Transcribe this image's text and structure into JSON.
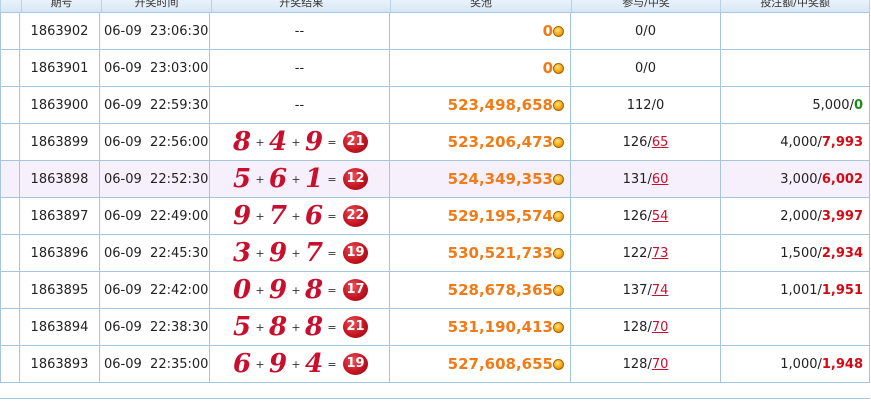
{
  "header": {
    "issue": "期号",
    "time": "开奖时间",
    "result": "开奖结果",
    "pool": "奖池",
    "participation": "参与/中奖",
    "bet_win": "投注额/中奖额"
  },
  "rows": [
    {
      "issue": "1863902",
      "date": "06-09",
      "time": "23:06:30",
      "result": "--",
      "d1": "",
      "d2": "",
      "d3": "",
      "sum": "",
      "pool": "0",
      "part": "0",
      "winners": "0",
      "bet": "",
      "won": "",
      "won_color": "",
      "highlight": false
    },
    {
      "issue": "1863901",
      "date": "06-09",
      "time": "23:03:00",
      "result": "--",
      "d1": "",
      "d2": "",
      "d3": "",
      "sum": "",
      "pool": "0",
      "part": "0",
      "winners": "0",
      "bet": "",
      "won": "",
      "won_color": "",
      "highlight": false
    },
    {
      "issue": "1863900",
      "date": "06-09",
      "time": "22:59:30",
      "result": "--",
      "d1": "",
      "d2": "",
      "d3": "",
      "sum": "",
      "pool": "523,498,658",
      "part": "112",
      "winners": "0",
      "bet": "5,000",
      "won": "0",
      "won_color": "green",
      "highlight": false
    },
    {
      "issue": "1863899",
      "date": "06-09",
      "time": "22:56:00",
      "result": "",
      "d1": "8",
      "d2": "4",
      "d3": "9",
      "sum": "21",
      "pool": "523,206,473",
      "part": "126",
      "winners": "65",
      "bet": "4,000",
      "won": "7,993",
      "won_color": "red",
      "highlight": false
    },
    {
      "issue": "1863898",
      "date": "06-09",
      "time": "22:52:30",
      "result": "",
      "d1": "5",
      "d2": "6",
      "d3": "1",
      "sum": "12",
      "pool": "524,349,353",
      "part": "131",
      "winners": "60",
      "bet": "3,000",
      "won": "6,002",
      "won_color": "red",
      "highlight": true
    },
    {
      "issue": "1863897",
      "date": "06-09",
      "time": "22:49:00",
      "result": "",
      "d1": "9",
      "d2": "7",
      "d3": "6",
      "sum": "22",
      "pool": "529,195,574",
      "part": "126",
      "winners": "54",
      "bet": "2,000",
      "won": "3,997",
      "won_color": "red",
      "highlight": false
    },
    {
      "issue": "1863896",
      "date": "06-09",
      "time": "22:45:30",
      "result": "",
      "d1": "3",
      "d2": "9",
      "d3": "7",
      "sum": "19",
      "pool": "530,521,733",
      "part": "122",
      "winners": "73",
      "bet": "1,500",
      "won": "2,934",
      "won_color": "red",
      "highlight": false
    },
    {
      "issue": "1863895",
      "date": "06-09",
      "time": "22:42:00",
      "result": "",
      "d1": "0",
      "d2": "9",
      "d3": "8",
      "sum": "17",
      "pool": "528,678,365",
      "part": "137",
      "winners": "74",
      "bet": "1,001",
      "won": "1,951",
      "won_color": "red",
      "highlight": false
    },
    {
      "issue": "1863894",
      "date": "06-09",
      "time": "22:38:30",
      "result": "",
      "d1": "5",
      "d2": "8",
      "d3": "8",
      "sum": "21",
      "pool": "531,190,413",
      "part": "128",
      "winners": "70",
      "bet": "",
      "won": "",
      "won_color": "",
      "highlight": false
    },
    {
      "issue": "1863893",
      "date": "06-09",
      "time": "22:35:00",
      "result": "",
      "d1": "6",
      "d2": "9",
      "d3": "4",
      "sum": "19",
      "pool": "527,608,655",
      "part": "128",
      "winners": "70",
      "bet": "1,000",
      "won": "1,948",
      "won_color": "red",
      "highlight": false
    }
  ],
  "ops": {
    "plus": "+",
    "equals": "="
  },
  "icons": {
    "coin": "gold-coin-icon",
    "sum": "red-ball-icon"
  },
  "colors": {
    "pool": "#f07b17",
    "win_red": "#d40a14",
    "win_green": "#1a8c12",
    "digit": "#c8102e",
    "border": "#a6c5df"
  }
}
